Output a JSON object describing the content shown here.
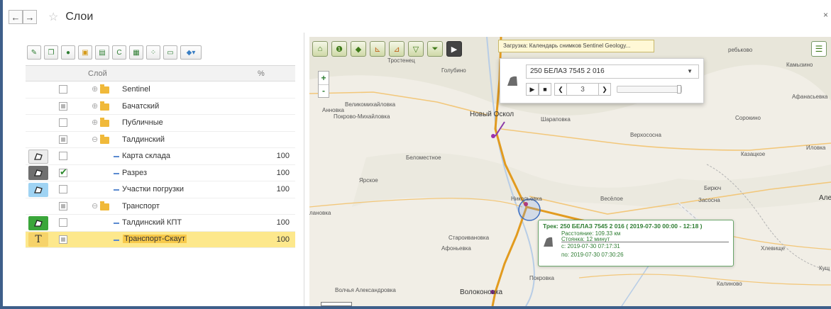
{
  "window": {
    "title": "Слои",
    "close": "×"
  },
  "nav": {
    "back": "←",
    "forward": "→",
    "star": "☆"
  },
  "toolbar": {
    "buttons": [
      {
        "name": "edit",
        "glyph": "✎"
      },
      {
        "name": "copy",
        "glyph": "❐"
      },
      {
        "name": "add",
        "glyph": "●"
      },
      {
        "name": "add-folder",
        "glyph": "▣"
      },
      {
        "name": "layer-props",
        "glyph": "▤"
      },
      {
        "name": "refresh",
        "glyph": "C"
      },
      {
        "name": "table",
        "glyph": "▦"
      },
      {
        "name": "points",
        "glyph": "⁘"
      },
      {
        "name": "window",
        "glyph": "▭"
      },
      {
        "name": "globe-menu",
        "glyph": "◆▾"
      }
    ]
  },
  "table": {
    "header": {
      "layer": "Слой",
      "percent": "%"
    },
    "rows": [
      {
        "label": "Sentinel",
        "percent": "",
        "check": "none",
        "type": "folder"
      },
      {
        "label": "Бачатский",
        "percent": "",
        "check": "partial",
        "type": "folder"
      },
      {
        "label": "Публичные",
        "percent": "",
        "check": "none",
        "type": "folder"
      },
      {
        "label": "Талдинский",
        "percent": "",
        "check": "partial",
        "type": "folder"
      },
      {
        "label": "Карта склада",
        "percent": "100",
        "check": "none",
        "type": "layer"
      },
      {
        "label": "Разрез",
        "percent": "100",
        "check": "checked",
        "type": "layer"
      },
      {
        "label": "Участки погрузки",
        "percent": "100",
        "check": "none",
        "type": "layer"
      },
      {
        "label": "Транспорт",
        "percent": "",
        "check": "partial",
        "type": "folder"
      },
      {
        "label": "Талдинский КПТ",
        "percent": "100",
        "check": "none",
        "type": "layer"
      },
      {
        "label": "Транспорт-Скаут",
        "percent": "100",
        "check": "partial",
        "type": "layer"
      }
    ],
    "row_icon_colors": {
      "karta": "#ececec",
      "razrez": "#6f6f6f",
      "uchastki": "#9fd3f3",
      "kpt": "#3aa63a",
      "scout": "#f6d36a"
    }
  },
  "map": {
    "loading_text": "Загрузка: Календарь снимков Sentinel Geology...",
    "zoom_in": "+",
    "zoom_out": "-",
    "player": {
      "vehicle": "250 БЕЛАЗ 7545 2 016",
      "frame": "3"
    },
    "places": [
      {
        "text": "Тростенец"
      },
      {
        "text": "Голубино"
      },
      {
        "text": "Анновка"
      },
      {
        "text": "Великомихайловка"
      },
      {
        "text": "Покрово-Михайловка"
      },
      {
        "text": "Новый Оскол"
      },
      {
        "text": "Шараповка"
      },
      {
        "text": "Верхососна"
      },
      {
        "text": "Сорокино"
      },
      {
        "text": "Казацкое"
      },
      {
        "text": "Иловка"
      },
      {
        "text": "Беломестное"
      },
      {
        "text": "Ярское"
      },
      {
        "text": "Никольевка"
      },
      {
        "text": "Весёлое"
      },
      {
        "text": "Бирюч"
      },
      {
        "text": "Засосна"
      },
      {
        "text": "Але"
      },
      {
        "text": "лановка"
      },
      {
        "text": "Староивановка"
      },
      {
        "text": "Афоньевка"
      },
      {
        "text": "Хлевище"
      },
      {
        "text": "Кущ"
      },
      {
        "text": "Покровка"
      },
      {
        "text": "Калиново"
      },
      {
        "text": "Волчья Александровка"
      },
      {
        "text": "Волоконовка"
      },
      {
        "text": "Камызино"
      },
      {
        "text": "Афанасьевка"
      },
      {
        "text": "ребьково"
      }
    ],
    "track": {
      "title": "Трек: 250 БЕЛАЗ 7545 2 016 ( 2019-07-30 00:00 - 12:18 )",
      "distance": "Расстояние: 109.33 км",
      "stop": "Стоянка: 12 минут",
      "from": "с: 2019-07-30 07:17:31",
      "to": "по: 2019-07-30 07:30:26"
    }
  }
}
